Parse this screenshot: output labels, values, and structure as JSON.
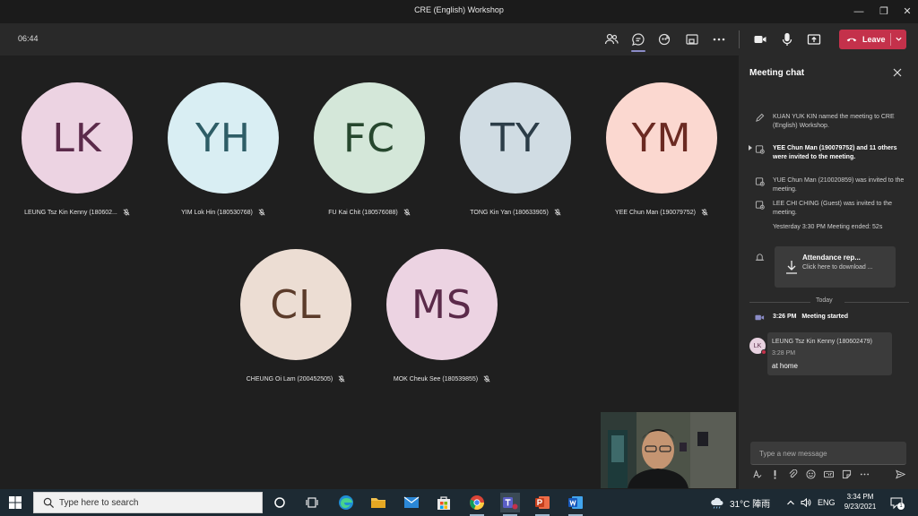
{
  "window": {
    "title": "CRE (English) Workshop",
    "minimize": "—",
    "maximize": "❐",
    "close": "✕"
  },
  "toolbar": {
    "timer": "06:44",
    "leave_label": "Leave"
  },
  "participants": [
    {
      "initials": "LK",
      "name": "LEUNG Tsz Kin Kenny (180602...",
      "bg": "#ecd3e2",
      "fg": "#5b2a4a"
    },
    {
      "initials": "YH",
      "name": "YIM Lok Hin (180530768)",
      "bg": "#d9eef3",
      "fg": "#2e5d66"
    },
    {
      "initials": "FC",
      "name": "FU Kai Chit (180576088)",
      "bg": "#d4e7d9",
      "fg": "#26472e"
    },
    {
      "initials": "TY",
      "name": "TONG Kin Yan (180633905)",
      "bg": "#d0dce3",
      "fg": "#2c3d48"
    },
    {
      "initials": "YM",
      "name": "YEE Chun Man (190079752)",
      "bg": "#fbd8d0",
      "fg": "#6b2a22"
    },
    {
      "initials": "CL",
      "name": "CHEUNG Oi Lam (200452505)",
      "bg": "#ecddd3",
      "fg": "#5b3b2a"
    },
    {
      "initials": "MS",
      "name": "MOK Cheuk See (180539855)",
      "bg": "#ecd3e2",
      "fg": "#5b2a4a"
    }
  ],
  "chat": {
    "title": "Meeting chat",
    "events": [
      {
        "text": "KUAN YUK KIN named the meeting to CRE (English) Workshop."
      },
      {
        "text": "YEE Chun Man (190079752) and 11 others were invited to the meeting."
      },
      {
        "text": "YUE Chun Man (210020859) was invited to the meeting."
      },
      {
        "text": "LEE CHI CHING (Guest) was invited to the meeting."
      },
      {
        "text": "Yesterday 3:30 PM   Meeting ended: 52s"
      }
    ],
    "attendance": {
      "title": "Attendance rep...",
      "subtitle": "Click here to download ..."
    },
    "today_label": "Today",
    "meeting_started": {
      "time": "3:26 PM",
      "label": "Meeting started"
    },
    "message": {
      "initials": "LK",
      "author": "LEUNG Tsz Kin Kenny (180602479)",
      "time": "3:28 PM",
      "text": "at home"
    },
    "compose_placeholder": "Type a new message"
  },
  "taskbar": {
    "search_placeholder": "Type here to search",
    "weather": "31°C  陣雨",
    "language": "ENG",
    "time": "3:34 PM",
    "date": "9/23/2021",
    "notification_count": "1"
  }
}
